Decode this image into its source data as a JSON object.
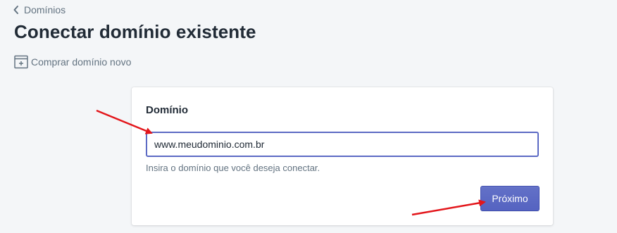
{
  "breadcrumb": {
    "label": "Domínios",
    "icon": "chevron-left-icon"
  },
  "page": {
    "title": "Conectar domínio existente"
  },
  "secondary_action": {
    "label": "Comprar domínio novo",
    "icon": "calendar-plus-icon"
  },
  "card": {
    "title": "Domínio",
    "input_value": "www.meudominio.com.br",
    "help_text": "Insira o domínio que você deseja conectar.",
    "next_label": "Próximo"
  },
  "colors": {
    "background": "#f4f6f8",
    "primary": "#5c6ac4",
    "text": "#212b36",
    "subdued": "#637381",
    "annotation_arrow": "#e3161b"
  }
}
